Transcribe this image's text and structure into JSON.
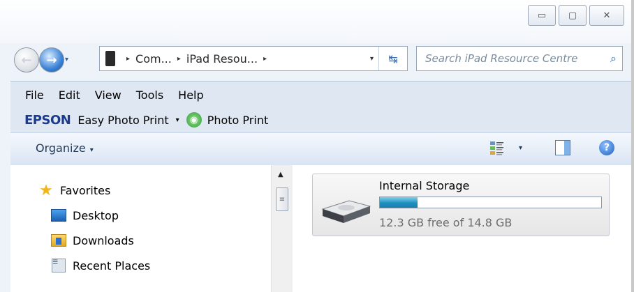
{
  "window": {
    "caption_buttons": {
      "minimize": "▭",
      "maximize": "▢",
      "close": "✕"
    }
  },
  "navigation": {
    "back_icon": "back-arrow-icon",
    "forward_icon": "forward-arrow-icon",
    "recent_dropdown": "▾"
  },
  "address": {
    "separator": "▸",
    "crumbs": [
      "Com...",
      "iPad Resou..."
    ],
    "dropdown": "▾",
    "refresh": "↹"
  },
  "search": {
    "placeholder": "Search iPad Resource Centre",
    "icon": "search-icon"
  },
  "menu": {
    "items": [
      "File",
      "Edit",
      "View",
      "Tools",
      "Help"
    ]
  },
  "epson": {
    "logo": "EPSON",
    "easy_photo_print": "Easy Photo Print",
    "dropdown": "▾",
    "photo_print": "Photo Print"
  },
  "commandbar": {
    "organize": "Organize",
    "caret": "▾",
    "views_caret": "▾",
    "help": "?"
  },
  "sidebar": {
    "favorites": "Favorites",
    "items": [
      "Desktop",
      "Downloads",
      "Recent Places"
    ]
  },
  "scrollbar": {
    "up": "▲",
    "grip": "≡"
  },
  "drive": {
    "name": "Internal Storage",
    "free_text": "12.3 GB free of 14.8 GB",
    "used_fraction": 0.17,
    "bar_color": "#1f8fbf"
  }
}
